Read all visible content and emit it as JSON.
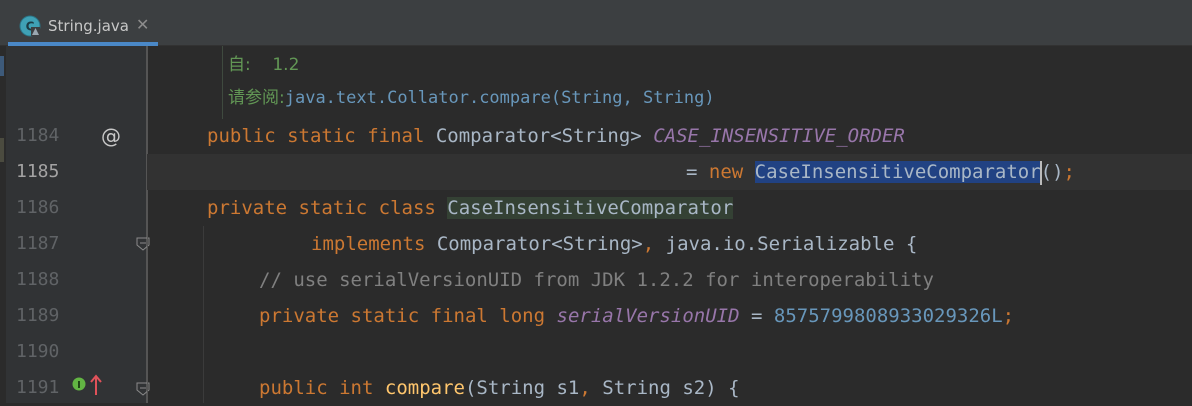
{
  "tab": {
    "filename": "String.java",
    "close_glyph": "✕",
    "icon": "java-class-icon"
  },
  "doc": {
    "since_label": "自:",
    "since_value": "1.2",
    "see_label": "请参阅:",
    "see_link": "java.text.Collator.compare(String, String)"
  },
  "gutter": {
    "override_marker": "@",
    "line_numbers": [
      "1184",
      "1185",
      "1186",
      "1187",
      "1188",
      "1189",
      "1190",
      "1191"
    ],
    "current_line": "1185"
  },
  "code": {
    "l1184": {
      "kw1": "public",
      "kw2": "static",
      "kw3": "final",
      "type": "Comparator<String>",
      "name": "CASE_INSENSITIVE_ORDER"
    },
    "l1185": {
      "eq": "= ",
      "kw": "new",
      "selected": "CaseInsensitiveComparator",
      "rest": "()",
      "semi": ";"
    },
    "l1186": {
      "kw1": "private",
      "kw2": "static",
      "kw3": "class",
      "name": "CaseInsensitiveComparator"
    },
    "l1187": {
      "kw": "implements",
      "rest": "Comparator<String>",
      "comma": ",",
      "rest2": "java.io.Serializable {"
    },
    "l1188": {
      "comment": "// use serialVersionUID from JDK 1.2.2 for interoperability"
    },
    "l1189": {
      "kw1": "private",
      "kw2": "static",
      "kw3": "final",
      "kw4": "long",
      "name": "serialVersionUID",
      "eq": "=",
      "value": "8575799808933029326L",
      "semi": ";"
    },
    "l1191": {
      "kw1": "public",
      "kw2": "int",
      "fn": "compare",
      "p1": "(String s1",
      "comma": ",",
      "p2": "String s2) {"
    }
  },
  "colors": {
    "background": "#2b2b2b",
    "keyword": "#cc7832",
    "constant": "#9876aa",
    "number": "#6897bb",
    "selection": "#214283",
    "doc_text": "#629755"
  }
}
